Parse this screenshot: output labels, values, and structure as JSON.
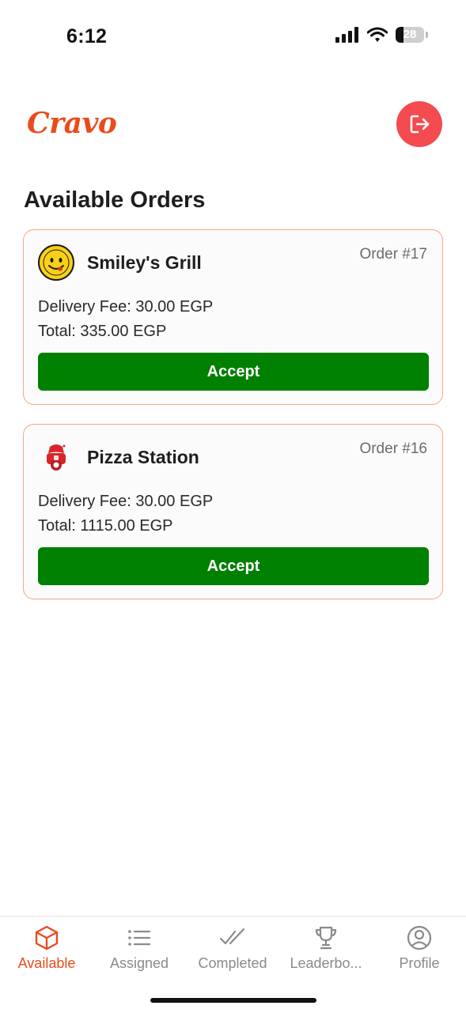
{
  "status": {
    "time": "6:12",
    "battery": "28",
    "battery_level": 0.28
  },
  "header": {
    "logo": "Cravo"
  },
  "page": {
    "title": "Available Orders"
  },
  "orders": [
    {
      "restaurant": "Smiley's Grill",
      "order_number": "Order #17",
      "delivery_fee": "Delivery Fee: 30.00 EGP",
      "total": "Total: 335.00 EGP",
      "accept_label": "Accept"
    },
    {
      "restaurant": "Pizza Station",
      "order_number": "Order #16",
      "delivery_fee": "Delivery Fee: 30.00 EGP",
      "total": "Total: 1115.00 EGP",
      "accept_label": "Accept"
    }
  ],
  "nav": [
    {
      "label": "Available",
      "icon": "box-icon",
      "active": true
    },
    {
      "label": "Assigned",
      "icon": "list-icon",
      "active": false
    },
    {
      "label": "Completed",
      "icon": "double-check-icon",
      "active": false
    },
    {
      "label": "Leaderbo...",
      "icon": "trophy-icon",
      "active": false
    },
    {
      "label": "Profile",
      "icon": "user-circle-icon",
      "active": false
    }
  ],
  "colors": {
    "brand": "#ea4b1c",
    "accept": "#008000",
    "logout": "#f34b4f",
    "card_border": "#f5a783",
    "inactive": "#8a8a8a"
  }
}
